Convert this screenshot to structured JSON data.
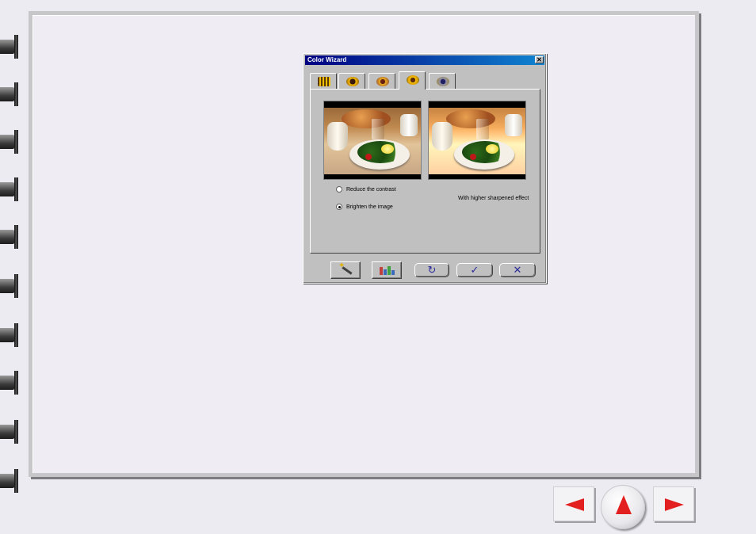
{
  "dialog": {
    "title": "Color Wizard",
    "close_glyph": "✕",
    "tabs": [
      {
        "icon": "sunflower-grid-icon",
        "active": false
      },
      {
        "icon": "sunflower-dark-icon",
        "active": false
      },
      {
        "icon": "sunflower-warm-icon",
        "active": false
      },
      {
        "icon": "sunflower-bright-icon",
        "active": true
      },
      {
        "icon": "sunflower-gray-icon",
        "active": false
      }
    ],
    "options": [
      {
        "label": "Reduce the contrast",
        "checked": false
      },
      {
        "label": "Brighten the image",
        "checked": true
      }
    ],
    "effect_note": "With higher sharpened effect",
    "buttons": {
      "wizard_icon": "magic-wand-icon",
      "histogram_icon": "histogram-icon",
      "reset_glyph": "↻",
      "ok_glyph": "✓",
      "cancel_glyph": "✕"
    }
  },
  "navigation": {
    "prev_icon": "left-arrow-icon",
    "home_icon": "up-arrow-icon",
    "next_icon": "right-arrow-icon",
    "accent_color": "#e32020"
  }
}
